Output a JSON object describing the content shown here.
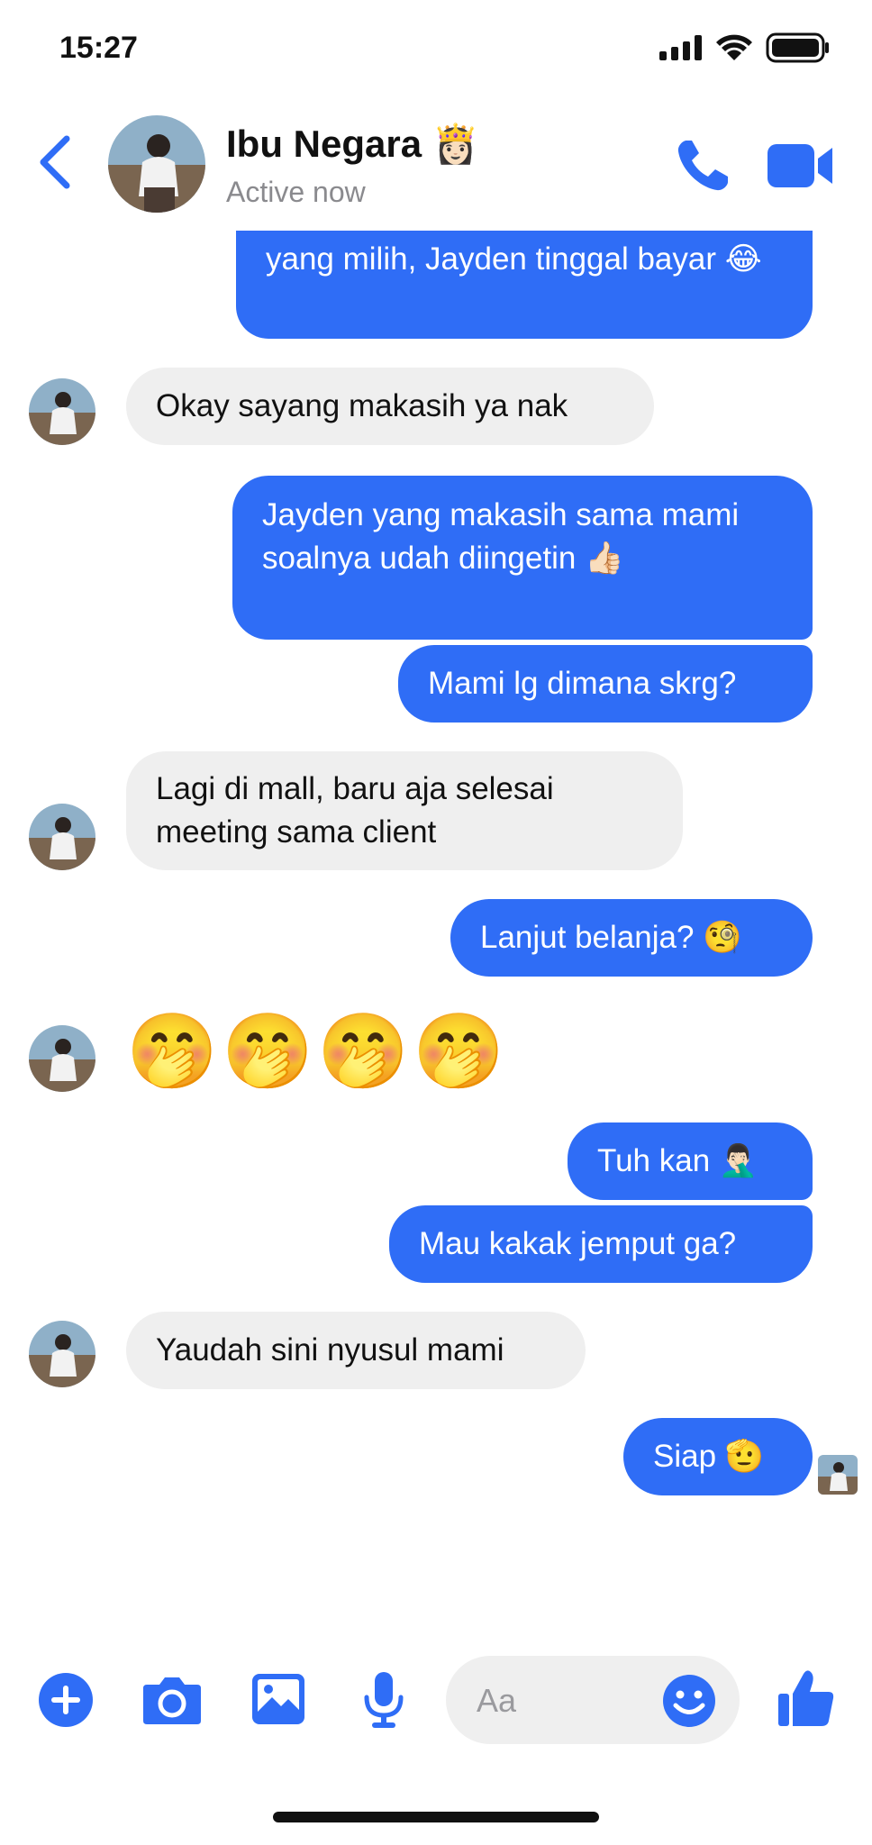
{
  "status_bar": {
    "time": "15:27"
  },
  "header": {
    "name": "Ibu Negara 👸🏻",
    "status": "Active now"
  },
  "messages": [
    {
      "dir": "out",
      "text": "yang milih, Jayden tinggal bayar 😂"
    },
    {
      "dir": "in",
      "text": "Okay sayang makasih ya nak"
    },
    {
      "dir": "out",
      "text": "Jayden yang makasih sama mami soalnya udah diingetin 👍🏻"
    },
    {
      "dir": "out",
      "text": "Mami lg dimana skrg?"
    },
    {
      "dir": "in",
      "text": "Lagi di mall, baru aja selesai meeting sama client"
    },
    {
      "dir": "out",
      "text": "Lanjut belanja? 🧐"
    },
    {
      "dir": "in",
      "text": "🤭🤭🤭🤭"
    },
    {
      "dir": "out",
      "text": "Tuh kan 🤦🏻‍♂️"
    },
    {
      "dir": "out",
      "text": "Mau kakak jemput ga?"
    },
    {
      "dir": "in",
      "text": "Yaudah sini nyusul mami"
    },
    {
      "dir": "out",
      "text": "Siap 🫡"
    }
  ],
  "composer": {
    "placeholder": "Aa"
  },
  "colors": {
    "accent": "#2f6df6",
    "incoming_bubble": "#efefef",
    "secondary_text": "#8a8a8e"
  },
  "icons": [
    "signal-icon",
    "wifi-icon",
    "battery-icon",
    "back-chevron-icon",
    "phone-icon",
    "video-camera-icon",
    "plus-icon",
    "camera-icon",
    "image-icon",
    "microphone-icon",
    "smile-icon",
    "thumbs-up-icon"
  ]
}
